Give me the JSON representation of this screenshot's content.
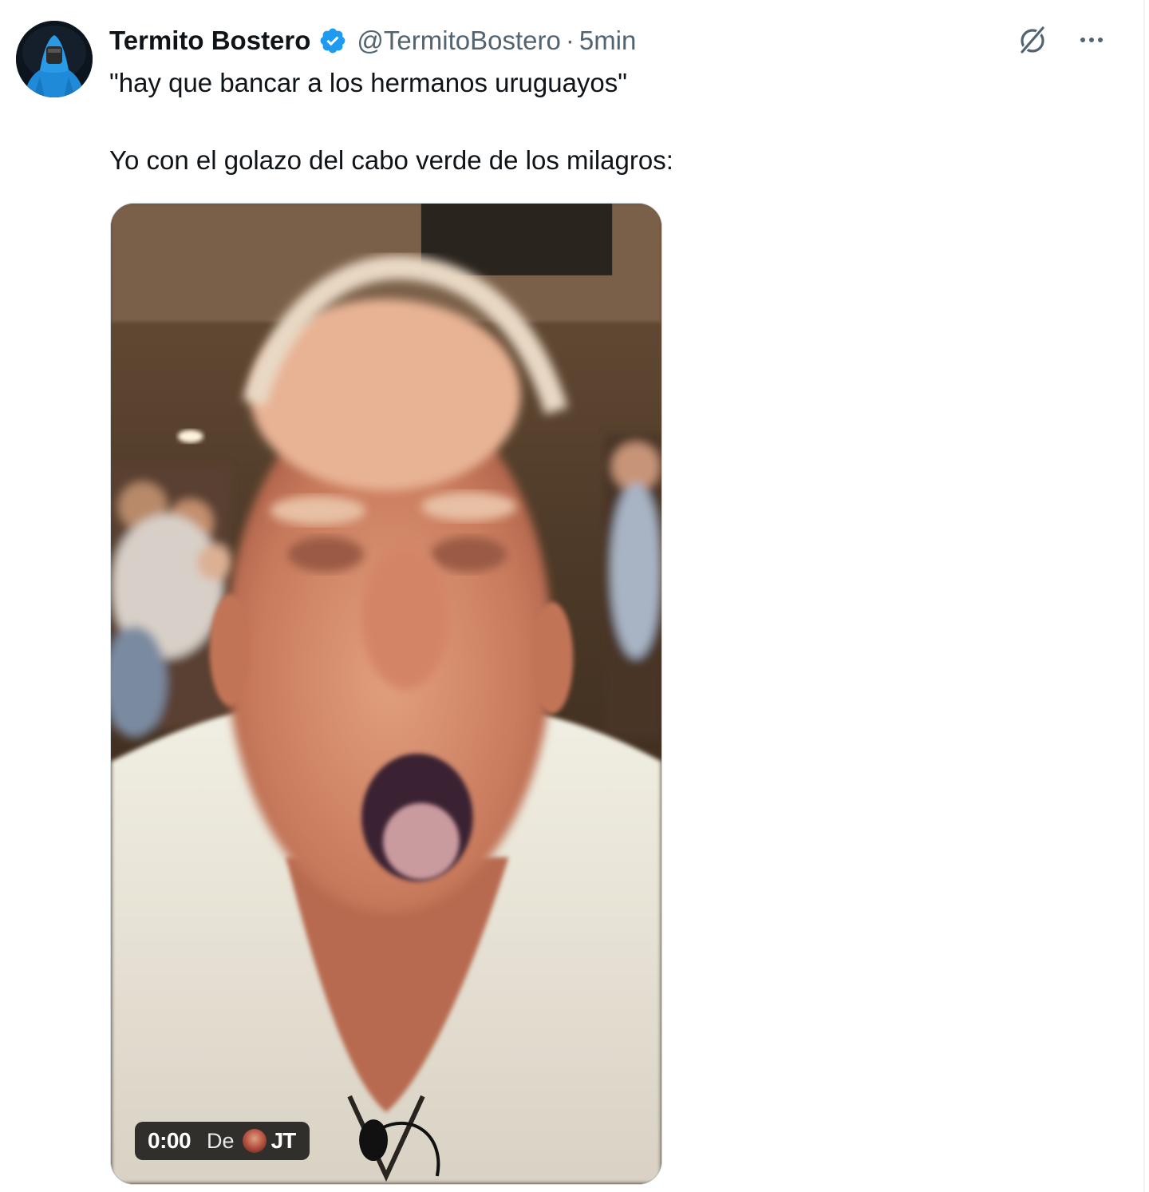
{
  "tweet": {
    "display_name": "Termito Bostero",
    "handle": "@TermitoBostero",
    "separator": "·",
    "time": "5min",
    "text_line1": "\"hay que bancar a los hermanos uruguayos\"",
    "text_line2": "Yo con el golazo del cabo verde de los milagros:",
    "verified": true,
    "verified_color": "#1d9bf0"
  },
  "actions": {
    "grok_icon": "grok-icon",
    "more_icon": "more-options-icon"
  },
  "media": {
    "type": "video",
    "time": "0:00",
    "from_label": "De",
    "source_name": "JT"
  }
}
